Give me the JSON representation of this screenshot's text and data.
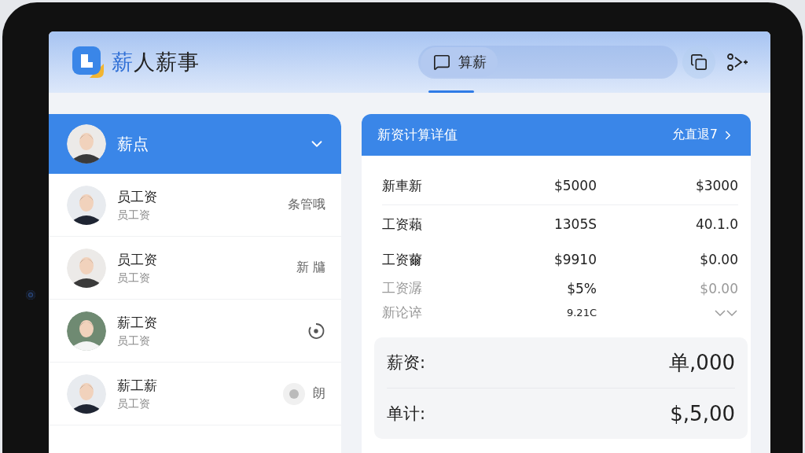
{
  "header": {
    "title_accent": "薪",
    "title_rest": "人薪事",
    "search": {
      "label": "算薪",
      "selected": true
    }
  },
  "employee_list": {
    "title": "薪点",
    "expanded": true,
    "items": [
      {
        "name": "员工资",
        "subtitle": "员工资",
        "trailing": {
          "kind": "text",
          "text": "条管哦"
        }
      },
      {
        "name": "员工资",
        "subtitle": "员工资",
        "trailing": {
          "kind": "text",
          "text": "新 牗"
        }
      },
      {
        "name": "薪工资",
        "subtitle": "员工资",
        "trailing": {
          "kind": "icon"
        }
      },
      {
        "name": "薪工薪",
        "subtitle": "员工资",
        "trailing": {
          "kind": "dot-text",
          "text": "朗"
        }
      }
    ]
  },
  "detail": {
    "title": "新资计算详值",
    "link": "允直退7",
    "rows": [
      {
        "label": "新車新",
        "col_2": "$5000",
        "col_3": "$3000",
        "muted": false
      },
      {
        "label": "工资藾",
        "col_2": "1305S",
        "col_3": "40.1.0",
        "muted": false
      },
      {
        "label": "工资薾",
        "col_2": "$9910",
        "col_3": "$0.00",
        "muted": false
      },
      {
        "label": "工资潺",
        "col_2": "$5%",
        "col_3": "$0.00",
        "muted": true
      },
      {
        "label": "新论谇",
        "col_2": "9.21C",
        "muted": true
      }
    ],
    "summary": [
      {
        "label": "薪资:",
        "value": "单,000"
      },
      {
        "label": "单计:",
        "value": "$,5,00"
      }
    ]
  }
}
